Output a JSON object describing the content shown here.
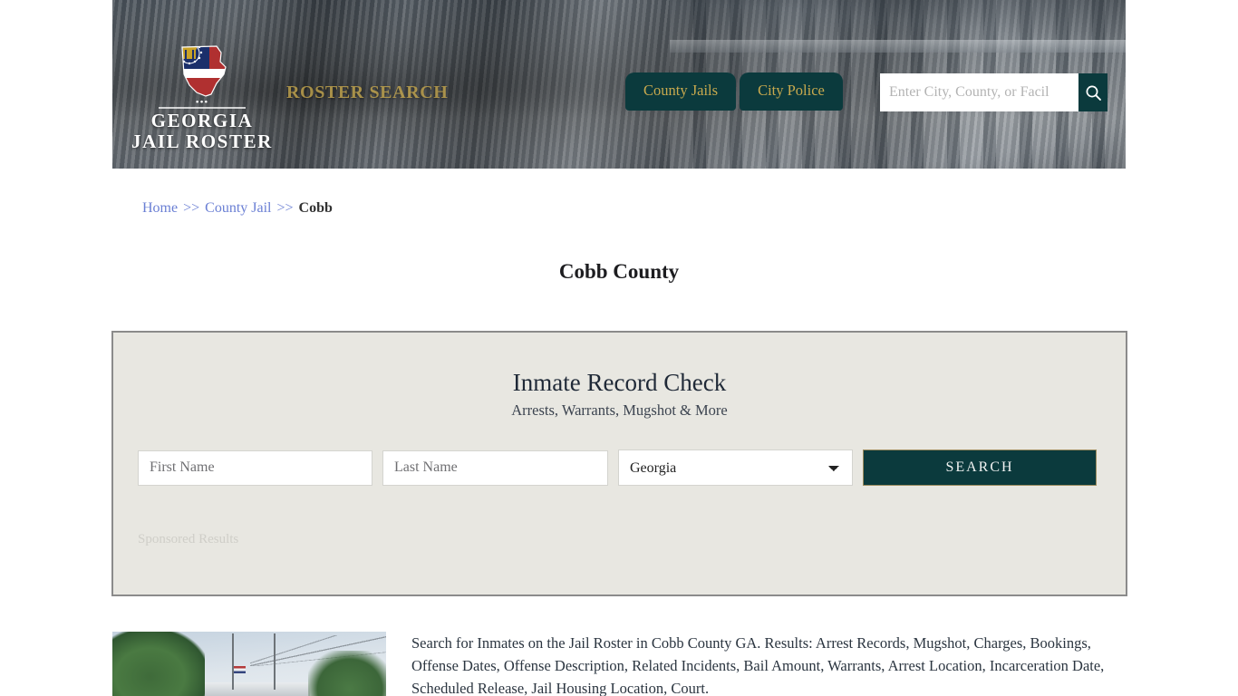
{
  "header": {
    "brand_line1": "GEORGIA",
    "brand_line2": "JAIL ROSTER",
    "logo_alt": "georgia-state-flag-logo",
    "tagline": "ROSTER SEARCH",
    "nav": [
      {
        "label": "County Jails",
        "name": "nav-tab-county-jails"
      },
      {
        "label": "City Police",
        "name": "nav-tab-city-police"
      }
    ],
    "search": {
      "placeholder": "Enter City, County, or Facil",
      "value": "",
      "button_icon": "search-icon"
    },
    "colors": {
      "tab_bg": "#0b3a3d",
      "tab_text": "#c8a94e",
      "tagline": "#c8a94e"
    }
  },
  "breadcrumb": {
    "home": "Home",
    "sep1": ">>",
    "county_jail": "County Jail",
    "sep2": ">>",
    "current": "Cobb"
  },
  "page": {
    "title": "Cobb County"
  },
  "record_check": {
    "title": "Inmate Record Check",
    "subtitle": "Arrests, Warrants, Mugshot & More",
    "first_name_placeholder": "First Name",
    "first_name_value": "",
    "last_name_placeholder": "Last Name",
    "last_name_value": "",
    "state_selected": "Georgia",
    "state_options": [
      "Georgia"
    ],
    "search_button": "SEARCH",
    "sponsored_label": "Sponsored Results",
    "panel_bg": "#e8e7e1",
    "panel_border": "#8b8b8b",
    "button_bg": "#0b3a3d"
  },
  "bottom": {
    "thumbnail_alt": "cobb-county-jail-photo",
    "description": "Search for Inmates on the Jail Roster in Cobb County GA. Results: Arrest Records, Mugshot, Charges, Bookings, Offense Dates, Offense Description, Related Incidents, Bail Amount, Warrants, Arrest Location, Incarceration Date, Scheduled Release, Jail Housing Location, Court."
  }
}
